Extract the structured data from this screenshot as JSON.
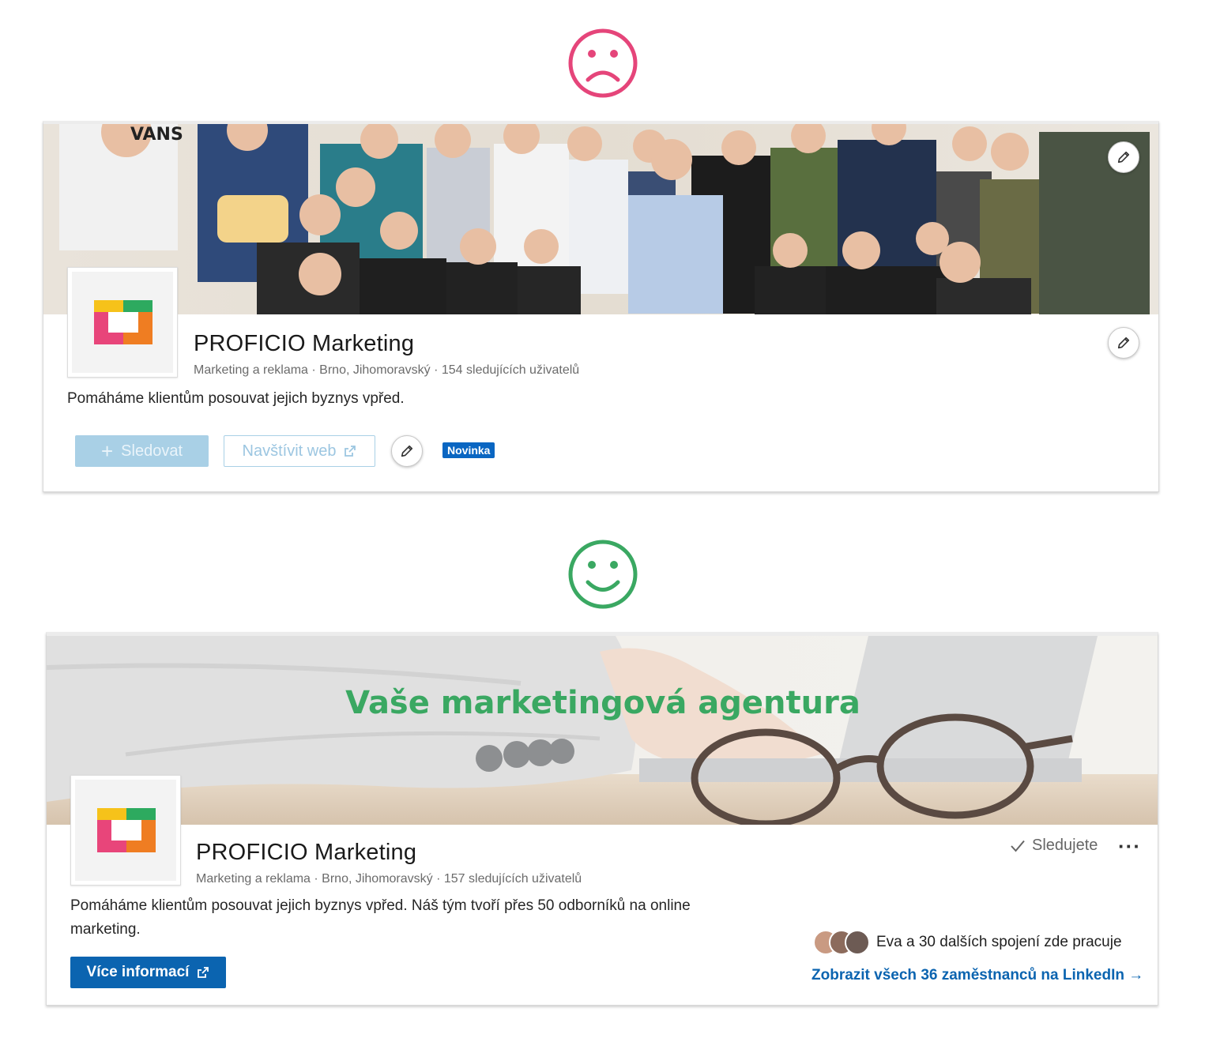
{
  "indicators": {
    "bad_icon": "sad-face-icon",
    "bad_color": "#e5457a",
    "good_icon": "smiley-face-icon",
    "good_color": "#3aa862"
  },
  "before": {
    "banner": {
      "type": "team-photo"
    },
    "company_name": "PROFICIO Marketing",
    "meta": "Marketing a reklama · Brno, Jihomoravský · 154 sledujících uživatelů",
    "description": "Pomáháme klientům posouvat jejich byznys vpřed.",
    "follow_button": "Sledovat",
    "visit_web_button": "Navštívit web",
    "badge": "Novinka",
    "edit_icon": "pencil-icon"
  },
  "after": {
    "banner": {
      "headline": "Vaše marketingová agentura",
      "type": "laptop-and-glasses-photo"
    },
    "company_name": "PROFICIO Marketing",
    "meta": "Marketing a reklama · Brno, Jihomoravský · 157 sledujících uživatelů",
    "description": "Pomáháme klientům posouvat jejich byznys vpřed. Náš tým tvoří přes 50 odborníků na online marketing.",
    "following_label": "Sledujete",
    "more_label": "···",
    "more_info_button": "Více informací",
    "connections_text": "Eva a 30 dalších spojení zde pracuje",
    "all_employees_link": "Zobrazit všech 36 zaměstnanců na LinkedIn →"
  },
  "colors": {
    "linkedin_blue": "#0b64b0",
    "logo_yellow": "#f6c21a",
    "logo_green": "#2daa5f",
    "logo_pink": "#e8457a",
    "logo_orange": "#ef7d22",
    "headline_green": "#3aa862"
  }
}
